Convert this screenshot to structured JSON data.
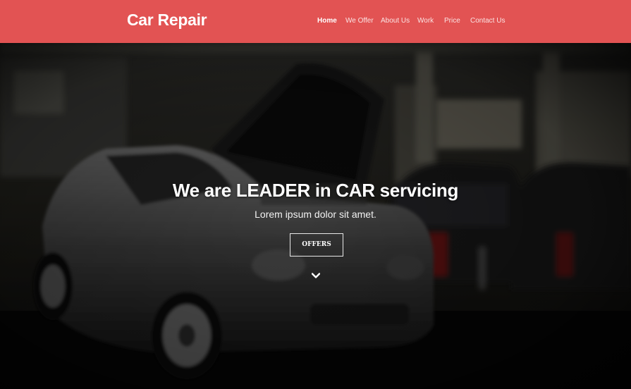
{
  "header": {
    "brand": "Car Repair",
    "nav": [
      {
        "label": "Home",
        "active": true
      },
      {
        "label": "We Offer"
      },
      {
        "label": "About Us"
      },
      {
        "label": "Work"
      },
      {
        "label": "Price"
      },
      {
        "label": "Contact Us"
      }
    ]
  },
  "hero": {
    "title": "We are LEADER in CAR servicing",
    "subtitle": "Lorem ipsum dolor sit amet.",
    "button_label": "OFFERS",
    "scroll_icon": "chevron-down-icon"
  },
  "colors": {
    "navbar": "#e25353",
    "text": "#ffffff"
  }
}
